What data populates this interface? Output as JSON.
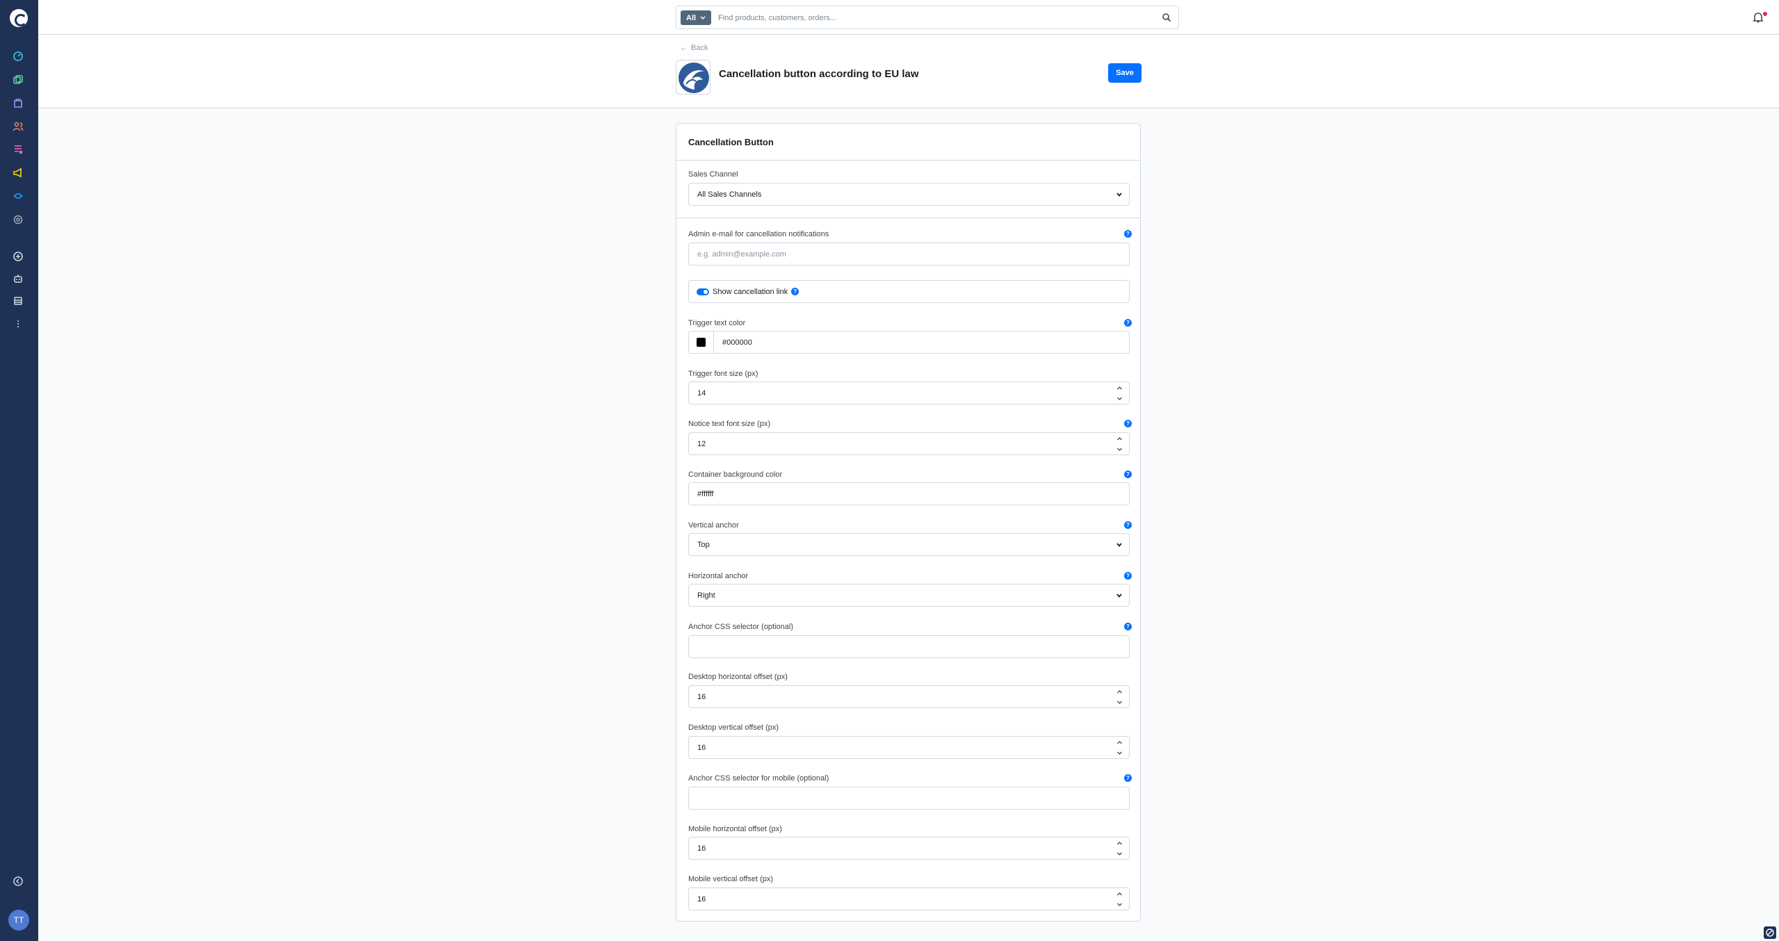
{
  "search": {
    "type_label": "All",
    "placeholder": "Find products, customers, orders..."
  },
  "sidebar": {
    "items": [
      {
        "name": "dashboard-icon",
        "color": "#3fc7de"
      },
      {
        "name": "catalog-icon",
        "color": "#57d9a3"
      },
      {
        "name": "orders-icon",
        "color": "#a092f0"
      },
      {
        "name": "customers-icon",
        "color": "#f88962"
      },
      {
        "name": "content-icon",
        "color": "#ff68b4"
      },
      {
        "name": "marketing-icon",
        "color": "#ffd700"
      },
      {
        "name": "extensions-icon",
        "color": "#189eff"
      },
      {
        "name": "settings-icon",
        "color": "#9aa8b5"
      }
    ],
    "avatar_initials": "TT"
  },
  "header": {
    "back_label": "Back",
    "title": "Cancellation button according to EU law",
    "save_label": "Save"
  },
  "card": {
    "title": "Cancellation Button",
    "sales_channel": {
      "label": "Sales Channel",
      "value": "All Sales Channels"
    },
    "admin_email": {
      "label": "Admin e-mail for cancellation notifications",
      "placeholder": "e.g. admin@example.com"
    },
    "show_link": {
      "label": "Show cancellation link",
      "enabled": true
    },
    "trigger_text_color": {
      "label": "Trigger text color",
      "value": "#000000"
    },
    "trigger_font_size": {
      "label": "Trigger font size (px)",
      "value": "14"
    },
    "notice_font_size": {
      "label": "Notice text font size (px)",
      "value": "12"
    },
    "container_bg": {
      "label": "Container background color",
      "value": "#ffffff"
    },
    "vertical_anchor": {
      "label": "Vertical anchor",
      "value": "Top"
    },
    "horizontal_anchor": {
      "label": "Horizontal anchor",
      "value": "Right"
    },
    "anchor_selector": {
      "label": "Anchor CSS selector (optional)",
      "value": ""
    },
    "desktop_h_offset": {
      "label": "Desktop horizontal offset (px)",
      "value": "16"
    },
    "desktop_v_offset": {
      "label": "Desktop vertical offset (px)",
      "value": "16"
    },
    "anchor_selector_mobile": {
      "label": "Anchor CSS selector for mobile (optional)",
      "value": ""
    },
    "mobile_h_offset": {
      "label": "Mobile horizontal offset (px)",
      "value": "16"
    },
    "mobile_v_offset": {
      "label": "Mobile vertical offset (px)",
      "value": "16"
    }
  },
  "colors": {
    "accent": "#0870ff",
    "sidebar_bg": "#1f3256"
  }
}
